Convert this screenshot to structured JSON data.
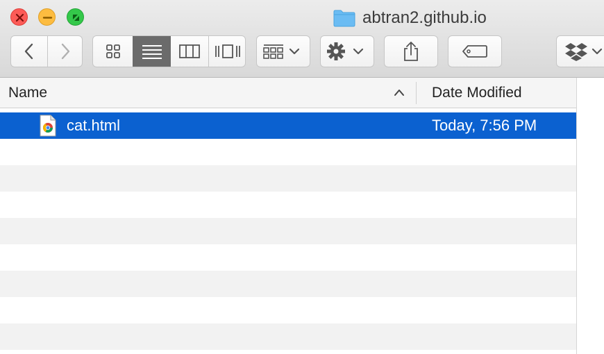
{
  "window": {
    "title": "abtran2.github.io",
    "folder_icon": "folder-icon"
  },
  "toolbar": {
    "buttons": [
      {
        "name": "back",
        "icon": "chevron-left-icon"
      },
      {
        "name": "forward",
        "icon": "chevron-right-icon"
      },
      {
        "name": "icon-view",
        "icon": "grid-icon"
      },
      {
        "name": "list-view",
        "icon": "list-icon",
        "active": true
      },
      {
        "name": "column-view",
        "icon": "columns-icon"
      },
      {
        "name": "cover-flow-view",
        "icon": "coverflow-icon"
      },
      {
        "name": "arrange",
        "icon": "arrange-icon"
      },
      {
        "name": "action",
        "icon": "gear-icon"
      },
      {
        "name": "share",
        "icon": "share-icon"
      },
      {
        "name": "tags",
        "icon": "tag-icon"
      },
      {
        "name": "dropbox",
        "icon": "dropbox-icon"
      }
    ]
  },
  "columns": {
    "name_label": "Name",
    "date_label": "Date Modified",
    "sort": "ascending"
  },
  "files": [
    {
      "name": "cat.html",
      "date": "Today, 7:56 PM",
      "icon": "chrome-html-file-icon",
      "selected": true
    }
  ],
  "colors": {
    "selection": "#0b61d0",
    "close": "#fc5b57",
    "minimize": "#fdbc40",
    "maximize": "#34c84a",
    "folder": "#6bbcf3"
  }
}
